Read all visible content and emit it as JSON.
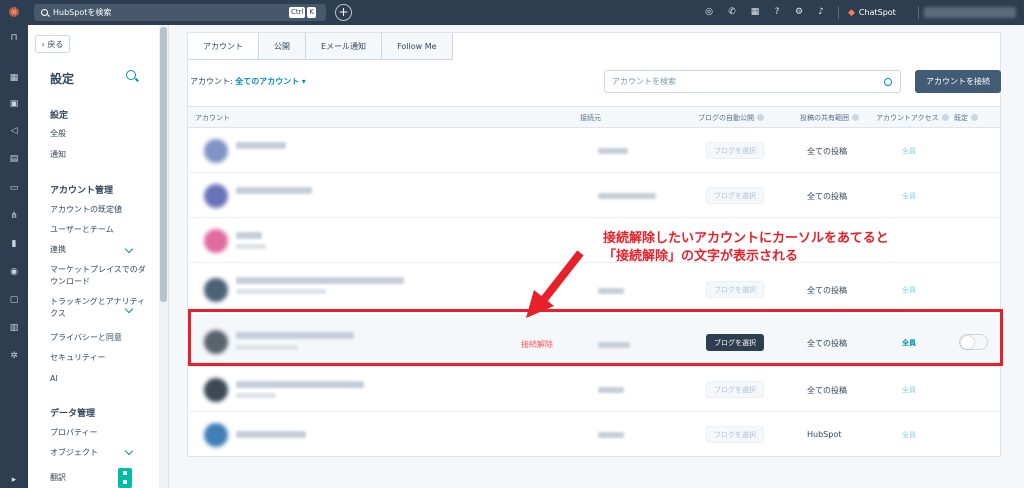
{
  "topbar": {
    "search_placeholder": "HubSpotを検索",
    "shortcut_keys": [
      "Ctrl",
      "K"
    ],
    "chatspot_label": "ChatSpot",
    "icons": [
      "help-icon",
      "phone-icon",
      "marketplace-icon",
      "help-circle-icon",
      "settings-icon",
      "bell-icon"
    ]
  },
  "sidebar": {
    "back_label": "戻る",
    "title": "設定",
    "sections": [
      {
        "title": "設定",
        "items": [
          "全般",
          "通知"
        ]
      },
      {
        "title": "アカウント管理",
        "items": [
          "アカウントの既定値",
          "ユーザーとチーム",
          "連携",
          "マーケットプレイスでのダウンロード",
          "トラッキングとアナリティクス",
          "プライバシーと同意",
          "セキュリティー",
          "AI"
        ]
      },
      {
        "title": "データ管理",
        "items": [
          "プロパティー",
          "オブジェクト",
          "翻訳"
        ]
      }
    ]
  },
  "main": {
    "tabs": [
      "アカウント",
      "公開",
      "Eメール通知",
      "Follow Me"
    ],
    "filter_label": "アカウント:",
    "filter_value": "全てのアカウント",
    "search_placeholder": "アカウントを検索",
    "connect_button": "アカウントを接続",
    "columns": [
      "アカウント",
      "接続元",
      "ブログの自動公開",
      "投稿の共有範囲",
      "アカウントアクセス",
      "既定"
    ],
    "rows": [
      {
        "blog_button": "ブログを選択",
        "share_scope": "全ての投稿",
        "access": "全員"
      },
      {
        "blog_button": "ブログを選択",
        "share_scope": "全ての投稿",
        "access": "全員"
      },
      {
        "blog_button": "ブログを選択",
        "share_scope": "全ての投稿",
        "access": "全員"
      },
      {
        "blog_button": "ブログを選択",
        "share_scope": "全ての投稿",
        "access": "全員"
      },
      {
        "blog_button": "ブログを選択",
        "share_scope": "全ての投稿",
        "access": "全員",
        "disconnect": "接続解除",
        "hovered": true
      },
      {
        "blog_button": "ブログを選択",
        "share_scope": "全ての投稿",
        "access": "全員"
      },
      {
        "blog_button": "ブログを選択",
        "share_scope": "HubSpot",
        "access": "全員"
      }
    ]
  },
  "annotation": {
    "line1": "接続解除したいアカウントにカーソルをあてると",
    "line2": "「接続解除」の文字が表示される",
    "color": "#e8202a"
  },
  "colors": {
    "nav_dark": "#2d3e50",
    "accent": "#0091ae",
    "brand": "#ff7a59"
  }
}
